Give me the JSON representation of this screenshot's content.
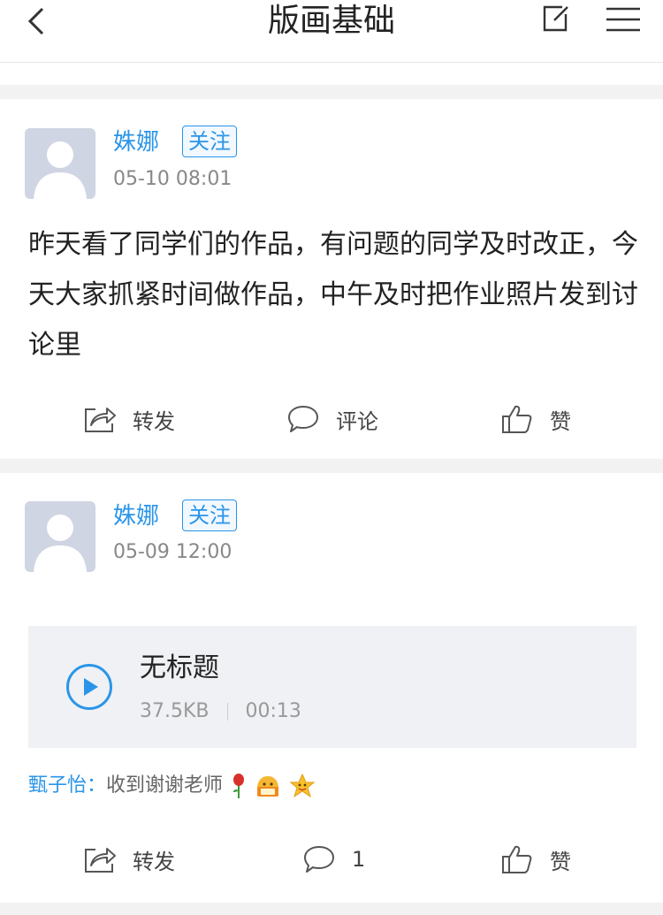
{
  "header": {
    "title": "版画基础"
  },
  "posts": [
    {
      "user": "姝娜",
      "follow_label": "关注",
      "time": "05-10 08:01",
      "content": "昨天看了同学们的作品，有问题的同学及时改正，今天大家抓紧时间做作品，中午及时把作业照片发到讨论里",
      "actions": {
        "forward": "转发",
        "comment": "评论",
        "like": "赞"
      }
    },
    {
      "user": "姝娜",
      "follow_label": "关注",
      "time": "05-09 12:00",
      "audio": {
        "title": "无标题",
        "size": "37.5KB",
        "duration": "00:13"
      },
      "comment": {
        "user": "甄子怡：",
        "text": "收到谢谢老师"
      },
      "actions": {
        "forward": "转发",
        "comment": "1",
        "like": "赞"
      }
    }
  ],
  "colors": {
    "accent": "#2a95e8",
    "divider": "#f2f2f2"
  },
  "icons": [
    "back-arrow-icon",
    "edit-icon",
    "menu-icon",
    "forward-icon",
    "comment-icon",
    "like-icon",
    "play-icon",
    "rose-emoji-icon",
    "received-emoji-icon",
    "star-emoji-icon"
  ]
}
